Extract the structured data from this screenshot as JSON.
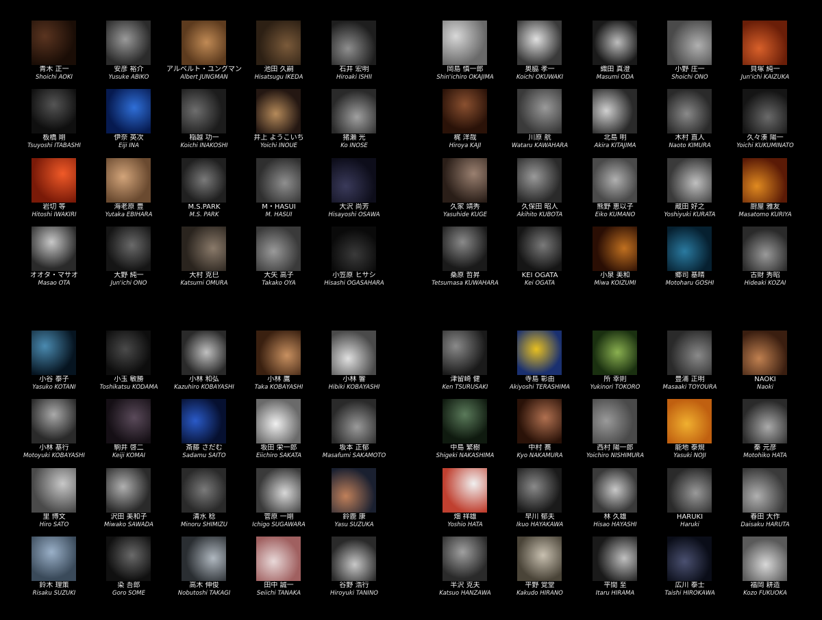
{
  "gallery": {
    "quadrants": [
      {
        "name": "top-left",
        "artists": [
          {
            "jp": "青木 正一",
            "en": "Shoichi AOKI",
            "c1": "#5a3420",
            "c2": "#1a0d06"
          },
          {
            "jp": "安彦 裕介",
            "en": "Yusuke ABIKO",
            "c1": "#9a9a9a",
            "c2": "#2b2b2b"
          },
          {
            "jp": "アルベルト・ユングマン",
            "en": "Albert JUNGMAN",
            "c1": "#c08a55",
            "c2": "#5d3b1e"
          },
          {
            "jp": "池田 久嗣",
            "en": "Hisatsugu IKEDA",
            "c1": "#7a5a3a",
            "c2": "#2d2014"
          },
          {
            "jp": "石井 宏明",
            "en": "Hiroaki ISHII",
            "c1": "#8e8e8e",
            "c2": "#1e1e1e"
          },
          {
            "jp": "板橋 剛",
            "en": "Tsuyoshi ITABASHI",
            "c1": "#555555",
            "c2": "#0f0f0f"
          },
          {
            "jp": "伊奈 英次",
            "en": "Eiji INA",
            "c1": "#2f6fd8",
            "c2": "#061a50"
          },
          {
            "jp": "稲越 功一",
            "en": "Koichi INAKOSHI",
            "c1": "#6e6e6e",
            "c2": "#1c1c1c"
          },
          {
            "jp": "井上 ようこいち",
            "en": "Yoichi INOUE",
            "c1": "#b58a5a",
            "c2": "#241712"
          },
          {
            "jp": "猪瀬 光",
            "en": "Ko INOSE",
            "c1": "#a0a0a0",
            "c2": "#2a2a2a"
          },
          {
            "jp": "岩切 等",
            "en": "Hitoshi IWAKIRI",
            "c1": "#f05a28",
            "c2": "#7a1a08"
          },
          {
            "jp": "海老原 豊",
            "en": "Yutaka EBIHARA",
            "c1": "#d2a47a",
            "c2": "#6a4a30"
          },
          {
            "jp": "M.S.PARK",
            "en": "M.S. PARK",
            "c1": "#7a7a7a",
            "c2": "#202020"
          },
          {
            "jp": "M・HASUI",
            "en": "M. HASUI",
            "c1": "#8f8f8f",
            "c2": "#2f2f2f"
          },
          {
            "jp": "大沢 尚芳",
            "en": "Hisayoshi OSAWA",
            "c1": "#3a3a5a",
            "c2": "#0d0d1a"
          },
          {
            "jp": "オオタ・マサオ",
            "en": "Masao OTA",
            "c1": "#c8c8c8",
            "c2": "#2a2a2a"
          },
          {
            "jp": "大野 純一",
            "en": "Jun'ichi ONO",
            "c1": "#6a6a6a",
            "c2": "#151515"
          },
          {
            "jp": "大村 克巳",
            "en": "Katsumi OMURA",
            "c1": "#8a7a6a",
            "c2": "#2a241e"
          },
          {
            "jp": "大矢 高子",
            "en": "Takako OYA",
            "c1": "#9a9a9a",
            "c2": "#3a3a3a"
          },
          {
            "jp": "小笠原 ヒサシ",
            "en": "Hisashi OGASAHARA",
            "c1": "#3a3a3a",
            "c2": "#0a0a0a"
          }
        ]
      },
      {
        "name": "top-right",
        "artists": [
          {
            "jp": "岡島 慎一郎",
            "en": "Shin'ichiro OKAJIMA",
            "c1": "#d8d8d8",
            "c2": "#6a6a6a"
          },
          {
            "jp": "奥脇 孝一",
            "en": "Koichi OKUWAKI",
            "c1": "#e0e0e0",
            "c2": "#3a3a3a"
          },
          {
            "jp": "織田 真澄",
            "en": "Masumi ODA",
            "c1": "#bdbdbd",
            "c2": "#1a1a1a"
          },
          {
            "jp": "小野 庄一",
            "en": "Shoichi ONO",
            "c1": "#b0b0b0",
            "c2": "#4a4a4a"
          },
          {
            "jp": "貝塚 純一",
            "en": "Jun'ichi KAIZUKA",
            "c1": "#d8602a",
            "c2": "#6a1e08"
          },
          {
            "jp": "梶 洋哉",
            "en": "Hiroya KAJI",
            "c1": "#8a5030",
            "c2": "#2a1208"
          },
          {
            "jp": "川原 航",
            "en": "Wataru KAWAHARA",
            "c1": "#9a9a9a",
            "c2": "#3a3a3a"
          },
          {
            "jp": "北島 明",
            "en": "Akira KITAJIMA",
            "c1": "#d0d0d0",
            "c2": "#2a2a2a"
          },
          {
            "jp": "木村 直人",
            "en": "Naoto KIMURA",
            "c1": "#8a8a8a",
            "c2": "#2a2a2a"
          },
          {
            "jp": "久々湊 陽一",
            "en": "Yoichi KUKUMINATO",
            "c1": "#6a6a6a",
            "c2": "#151515"
          },
          {
            "jp": "久家 靖秀",
            "en": "Yasuhide KUGE",
            "c1": "#9a8070",
            "c2": "#2a1e18"
          },
          {
            "jp": "久保田 昭人",
            "en": "Akihito KUBOTA",
            "c1": "#9a9a9a",
            "c2": "#2a2a2a"
          },
          {
            "jp": "熊野 恵以子",
            "en": "Eiko KUMANO",
            "c1": "#b0b0b0",
            "c2": "#4a4a4a"
          },
          {
            "jp": "蔵田 好之",
            "en": "Yoshiyuki KURATA",
            "c1": "#c0c0c0",
            "c2": "#3a3a3a"
          },
          {
            "jp": "厨屋 雅友",
            "en": "Masatomo KURIYA",
            "c1": "#e08a20",
            "c2": "#5a1a06"
          },
          {
            "jp": "桑原 哲昇",
            "en": "Tetsumasa KUWAHARA",
            "c1": "#8a8a8a",
            "c2": "#1a1a1a"
          },
          {
            "jp": "KEI OGATA",
            "en": "Kei OGATA",
            "c1": "#7a7a7a",
            "c2": "#151515"
          },
          {
            "jp": "小泉 美和",
            "en": "Miwa KOIZUMI",
            "c1": "#c07020",
            "c2": "#2a0e04"
          },
          {
            "jp": "郷司 基晴",
            "en": "Motoharu GOSHI",
            "c1": "#2a7aa0",
            "c2": "#062030"
          },
          {
            "jp": "古財 秀昭",
            "en": "Hideaki KOZAI",
            "c1": "#9a9a9a",
            "c2": "#2a2a2a"
          }
        ]
      },
      {
        "name": "bottom-left",
        "artists": [
          {
            "jp": "小谷 泰子",
            "en": "Yasuko KOTANI",
            "c1": "#4a8ab0",
            "c2": "#061420"
          },
          {
            "jp": "小玉 敏勝",
            "en": "Toshikatsu KODAMA",
            "c1": "#4a4a4a",
            "c2": "#0d0d0d"
          },
          {
            "jp": "小林 和弘",
            "en": "Kazuhiro KOBAYASHI",
            "c1": "#c0c0c0",
            "c2": "#2a2a2a"
          },
          {
            "jp": "小林 鷹",
            "en": "Taka KOBAYASHI",
            "c1": "#c89060",
            "c2": "#3a2010"
          },
          {
            "jp": "小林 響",
            "en": "Hibiki KOBAYASHI",
            "c1": "#e0e0e0",
            "c2": "#4a4a4a"
          },
          {
            "jp": "小林 基行",
            "en": "Motoyuki KOBAYASHI",
            "c1": "#aaaaaa",
            "c2": "#2a2a2a"
          },
          {
            "jp": "駒井 啓二",
            "en": "Keiji KOMAI",
            "c1": "#5a4a5a",
            "c2": "#150f15"
          },
          {
            "jp": "斎藤 さだむ",
            "en": "Sadamu SAITO",
            "c1": "#2a5ac8",
            "c2": "#061030"
          },
          {
            "jp": "坂田 栄一郎",
            "en": "Eiichiro SAKATA",
            "c1": "#f0f0f0",
            "c2": "#6a6a6a"
          },
          {
            "jp": "坂本 正郁",
            "en": "Masafumi SAKAMOTO",
            "c1": "#9a9a9a",
            "c2": "#2a2a2a"
          },
          {
            "jp": "里 博文",
            "en": "Hiro SATO",
            "c1": "#c8c8c8",
            "c2": "#4a4a4a"
          },
          {
            "jp": "沢田 美和子",
            "en": "Miwako SAWADA",
            "c1": "#b0b0b0",
            "c2": "#2a2a2a"
          },
          {
            "jp": "清水 稔",
            "en": "Minoru SHIMIZU",
            "c1": "#7a7a7a",
            "c2": "#2a2a2a"
          },
          {
            "jp": "菅原 一剛",
            "en": "Ichigo SUGAWARA",
            "c1": "#d8d8d8",
            "c2": "#3a3a3a"
          },
          {
            "jp": "鈴鹿 康",
            "en": "Yasu SUZUKA",
            "c1": "#c0805a",
            "c2": "#1a2030"
          },
          {
            "jp": "鈴木 理策",
            "en": "Risaku SUZUKI",
            "c1": "#9ab0c8",
            "c2": "#3a4a5a"
          },
          {
            "jp": "染 吾郎",
            "en": "Goro SOME",
            "c1": "#6a6a6a",
            "c2": "#101010"
          },
          {
            "jp": "高木 伸俊",
            "en": "Nobutoshi TAKAGI",
            "c1": "#b0b8c0",
            "c2": "#2a2e32"
          },
          {
            "jp": "田中 誠一",
            "en": "Seiichi TANAKA",
            "c1": "#e8d8d8",
            "c2": "#a06060"
          },
          {
            "jp": "谷野 浩行",
            "en": "Hiroyuki TANINO",
            "c1": "#c8c8c8",
            "c2": "#2a2a2a"
          }
        ]
      },
      {
        "name": "bottom-right",
        "artists": [
          {
            "jp": "津留崎 健",
            "en": "Ken TSURUSAKI",
            "c1": "#8a8a8a",
            "c2": "#1a1a1a"
          },
          {
            "jp": "寺島 彰由",
            "en": "Akiyoshi TERASHIMA",
            "c1": "#e8c020",
            "c2": "#1a3070"
          },
          {
            "jp": "所 幸則",
            "en": "Yukinori TOKORO",
            "c1": "#8ab050",
            "c2": "#1a3010"
          },
          {
            "jp": "豊浦 正明",
            "en": "Masaaki TOYOURA",
            "c1": "#8a8a8a",
            "c2": "#2a2a2a"
          },
          {
            "jp": "NAOKI",
            "en": "Naoki",
            "c1": "#c08050",
            "c2": "#3a1e10"
          },
          {
            "jp": "中島 繁樹",
            "en": "Shigeki NAKASHIMA",
            "c1": "#5a7a5a",
            "c2": "#0f1a0f"
          },
          {
            "jp": "中村 蕎",
            "en": "Kyo NAKAMURA",
            "c1": "#b07050",
            "c2": "#2a1208"
          },
          {
            "jp": "西村 陽一郎",
            "en": "Yoichiro NISHIMURA",
            "c1": "#9a9a9a",
            "c2": "#4a4a4a"
          },
          {
            "jp": "能地 泰規",
            "en": "Yasuki NOJI",
            "c1": "#f0b030",
            "c2": "#c06010"
          },
          {
            "jp": "秦 元彦",
            "en": "Motohiko HATA",
            "c1": "#aaaaaa",
            "c2": "#2a2a2a"
          },
          {
            "jp": "畑 祥雄",
            "en": "Yoshio HATA",
            "c1": "#f0f0f0",
            "c2": "#c04030"
          },
          {
            "jp": "早川 郁夫",
            "en": "Ikuo HAYAKAWA",
            "c1": "#8a8a8a",
            "c2": "#1a1a1a"
          },
          {
            "jp": "林 久雄",
            "en": "Hisao HAYASHI",
            "c1": "#c8c8c8",
            "c2": "#3a3a3a"
          },
          {
            "jp": "HARUKI",
            "en": "Haruki",
            "c1": "#9a9a9a",
            "c2": "#2a2a2a"
          },
          {
            "jp": "春田 大作",
            "en": "Daisaku HARUTA",
            "c1": "#b0b0b0",
            "c2": "#3a3a3a"
          },
          {
            "jp": "半沢 克夫",
            "en": "Katsuo HANZAWA",
            "c1": "#a0a0a0",
            "c2": "#2a2a2a"
          },
          {
            "jp": "平野 覚堂",
            "en": "Kakudo HIRANO",
            "c1": "#c8c0b0",
            "c2": "#4a4438"
          },
          {
            "jp": "平間 至",
            "en": "Itaru HIRAMA",
            "c1": "#c0c0c0",
            "c2": "#1a1a1a"
          },
          {
            "jp": "広川 泰士",
            "en": "Taishi HIROKAWA",
            "c1": "#4a5070",
            "c2": "#0a0d18"
          },
          {
            "jp": "福岡 耕造",
            "en": "Kozo FUKUOKA",
            "c1": "#d8d8d8",
            "c2": "#5a5a5a"
          }
        ]
      }
    ]
  }
}
